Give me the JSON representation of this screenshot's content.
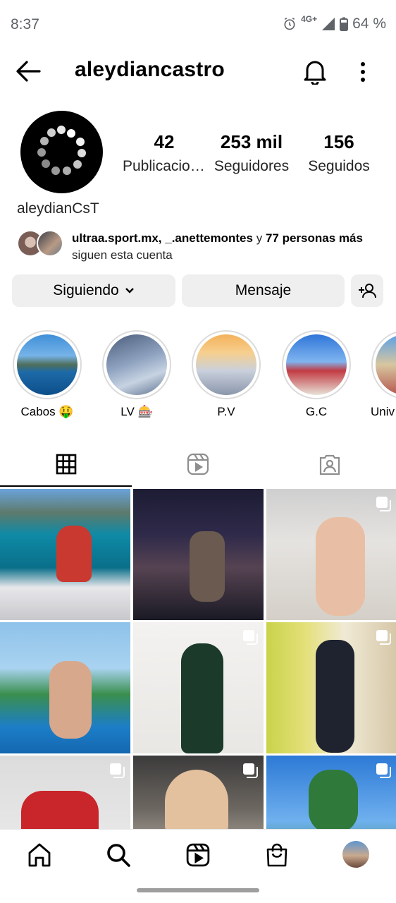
{
  "status_bar": {
    "time": "8:37",
    "network": "4G+",
    "battery": "64 %"
  },
  "header": {
    "username": "aleydiancastro"
  },
  "profile": {
    "display_name": "aleydianCsT",
    "stats": [
      {
        "value": "42",
        "label": "Publicaciones"
      },
      {
        "value": "253 mil",
        "label": "Seguidores"
      },
      {
        "value": "156",
        "label": "Seguidos"
      }
    ],
    "followed_by": {
      "accounts": "ultraa.sport.mx, _.anettemontes",
      "connector": "y",
      "others": "77 personas más",
      "suffix": "siguen esta cuenta"
    }
  },
  "actions": {
    "following_label": "Siguiendo",
    "message_label": "Mensaje"
  },
  "highlights": [
    {
      "label": "Cabos 🤑"
    },
    {
      "label": "LV 🎰"
    },
    {
      "label": "P.V"
    },
    {
      "label": "G.C"
    },
    {
      "label": "Univ"
    }
  ],
  "tabs": [
    {
      "name": "posts",
      "active": true
    },
    {
      "name": "reels",
      "active": false
    },
    {
      "name": "tagged",
      "active": false
    }
  ],
  "accent_colors": {
    "text": "#000000",
    "button_bg": "#efefef",
    "muted": "#5f6368"
  }
}
